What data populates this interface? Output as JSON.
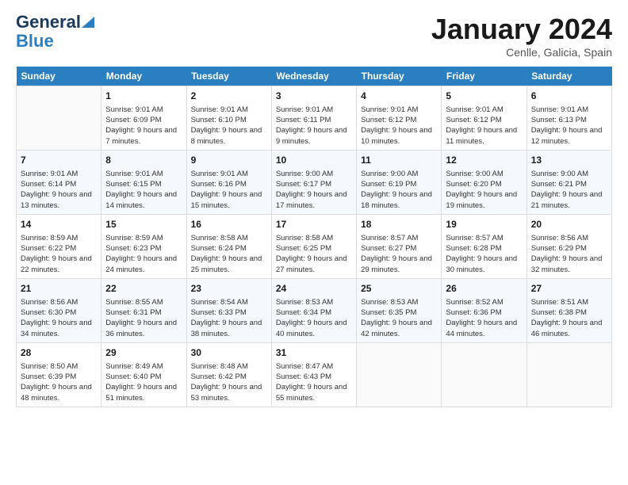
{
  "logo": {
    "line1": "General",
    "line2": "Blue"
  },
  "title": "January 2024",
  "subtitle": "Cenlle, Galicia, Spain",
  "weekdays": [
    "Sunday",
    "Monday",
    "Tuesday",
    "Wednesday",
    "Thursday",
    "Friday",
    "Saturday"
  ],
  "weeks": [
    [
      {
        "day": "",
        "sunrise": "",
        "sunset": "",
        "daylight": ""
      },
      {
        "day": "1",
        "sunrise": "Sunrise: 9:01 AM",
        "sunset": "Sunset: 6:09 PM",
        "daylight": "Daylight: 9 hours and 7 minutes."
      },
      {
        "day": "2",
        "sunrise": "Sunrise: 9:01 AM",
        "sunset": "Sunset: 6:10 PM",
        "daylight": "Daylight: 9 hours and 8 minutes."
      },
      {
        "day": "3",
        "sunrise": "Sunrise: 9:01 AM",
        "sunset": "Sunset: 6:11 PM",
        "daylight": "Daylight: 9 hours and 9 minutes."
      },
      {
        "day": "4",
        "sunrise": "Sunrise: 9:01 AM",
        "sunset": "Sunset: 6:12 PM",
        "daylight": "Daylight: 9 hours and 10 minutes."
      },
      {
        "day": "5",
        "sunrise": "Sunrise: 9:01 AM",
        "sunset": "Sunset: 6:12 PM",
        "daylight": "Daylight: 9 hours and 11 minutes."
      },
      {
        "day": "6",
        "sunrise": "Sunrise: 9:01 AM",
        "sunset": "Sunset: 6:13 PM",
        "daylight": "Daylight: 9 hours and 12 minutes."
      }
    ],
    [
      {
        "day": "7",
        "sunrise": "Sunrise: 9:01 AM",
        "sunset": "Sunset: 6:14 PM",
        "daylight": "Daylight: 9 hours and 13 minutes."
      },
      {
        "day": "8",
        "sunrise": "Sunrise: 9:01 AM",
        "sunset": "Sunset: 6:15 PM",
        "daylight": "Daylight: 9 hours and 14 minutes."
      },
      {
        "day": "9",
        "sunrise": "Sunrise: 9:01 AM",
        "sunset": "Sunset: 6:16 PM",
        "daylight": "Daylight: 9 hours and 15 minutes."
      },
      {
        "day": "10",
        "sunrise": "Sunrise: 9:00 AM",
        "sunset": "Sunset: 6:17 PM",
        "daylight": "Daylight: 9 hours and 17 minutes."
      },
      {
        "day": "11",
        "sunrise": "Sunrise: 9:00 AM",
        "sunset": "Sunset: 6:19 PM",
        "daylight": "Daylight: 9 hours and 18 minutes."
      },
      {
        "day": "12",
        "sunrise": "Sunrise: 9:00 AM",
        "sunset": "Sunset: 6:20 PM",
        "daylight": "Daylight: 9 hours and 19 minutes."
      },
      {
        "day": "13",
        "sunrise": "Sunrise: 9:00 AM",
        "sunset": "Sunset: 6:21 PM",
        "daylight": "Daylight: 9 hours and 21 minutes."
      }
    ],
    [
      {
        "day": "14",
        "sunrise": "Sunrise: 8:59 AM",
        "sunset": "Sunset: 6:22 PM",
        "daylight": "Daylight: 9 hours and 22 minutes."
      },
      {
        "day": "15",
        "sunrise": "Sunrise: 8:59 AM",
        "sunset": "Sunset: 6:23 PM",
        "daylight": "Daylight: 9 hours and 24 minutes."
      },
      {
        "day": "16",
        "sunrise": "Sunrise: 8:58 AM",
        "sunset": "Sunset: 6:24 PM",
        "daylight": "Daylight: 9 hours and 25 minutes."
      },
      {
        "day": "17",
        "sunrise": "Sunrise: 8:58 AM",
        "sunset": "Sunset: 6:25 PM",
        "daylight": "Daylight: 9 hours and 27 minutes."
      },
      {
        "day": "18",
        "sunrise": "Sunrise: 8:57 AM",
        "sunset": "Sunset: 6:27 PM",
        "daylight": "Daylight: 9 hours and 29 minutes."
      },
      {
        "day": "19",
        "sunrise": "Sunrise: 8:57 AM",
        "sunset": "Sunset: 6:28 PM",
        "daylight": "Daylight: 9 hours and 30 minutes."
      },
      {
        "day": "20",
        "sunrise": "Sunrise: 8:56 AM",
        "sunset": "Sunset: 6:29 PM",
        "daylight": "Daylight: 9 hours and 32 minutes."
      }
    ],
    [
      {
        "day": "21",
        "sunrise": "Sunrise: 8:56 AM",
        "sunset": "Sunset: 6:30 PM",
        "daylight": "Daylight: 9 hours and 34 minutes."
      },
      {
        "day": "22",
        "sunrise": "Sunrise: 8:55 AM",
        "sunset": "Sunset: 6:31 PM",
        "daylight": "Daylight: 9 hours and 36 minutes."
      },
      {
        "day": "23",
        "sunrise": "Sunrise: 8:54 AM",
        "sunset": "Sunset: 6:33 PM",
        "daylight": "Daylight: 9 hours and 38 minutes."
      },
      {
        "day": "24",
        "sunrise": "Sunrise: 8:53 AM",
        "sunset": "Sunset: 6:34 PM",
        "daylight": "Daylight: 9 hours and 40 minutes."
      },
      {
        "day": "25",
        "sunrise": "Sunrise: 8:53 AM",
        "sunset": "Sunset: 6:35 PM",
        "daylight": "Daylight: 9 hours and 42 minutes."
      },
      {
        "day": "26",
        "sunrise": "Sunrise: 8:52 AM",
        "sunset": "Sunset: 6:36 PM",
        "daylight": "Daylight: 9 hours and 44 minutes."
      },
      {
        "day": "27",
        "sunrise": "Sunrise: 8:51 AM",
        "sunset": "Sunset: 6:38 PM",
        "daylight": "Daylight: 9 hours and 46 minutes."
      }
    ],
    [
      {
        "day": "28",
        "sunrise": "Sunrise: 8:50 AM",
        "sunset": "Sunset: 6:39 PM",
        "daylight": "Daylight: 9 hours and 48 minutes."
      },
      {
        "day": "29",
        "sunrise": "Sunrise: 8:49 AM",
        "sunset": "Sunset: 6:40 PM",
        "daylight": "Daylight: 9 hours and 51 minutes."
      },
      {
        "day": "30",
        "sunrise": "Sunrise: 8:48 AM",
        "sunset": "Sunset: 6:42 PM",
        "daylight": "Daylight: 9 hours and 53 minutes."
      },
      {
        "day": "31",
        "sunrise": "Sunrise: 8:47 AM",
        "sunset": "Sunset: 6:43 PM",
        "daylight": "Daylight: 9 hours and 55 minutes."
      },
      {
        "day": "",
        "sunrise": "",
        "sunset": "",
        "daylight": ""
      },
      {
        "day": "",
        "sunrise": "",
        "sunset": "",
        "daylight": ""
      },
      {
        "day": "",
        "sunrise": "",
        "sunset": "",
        "daylight": ""
      }
    ]
  ]
}
